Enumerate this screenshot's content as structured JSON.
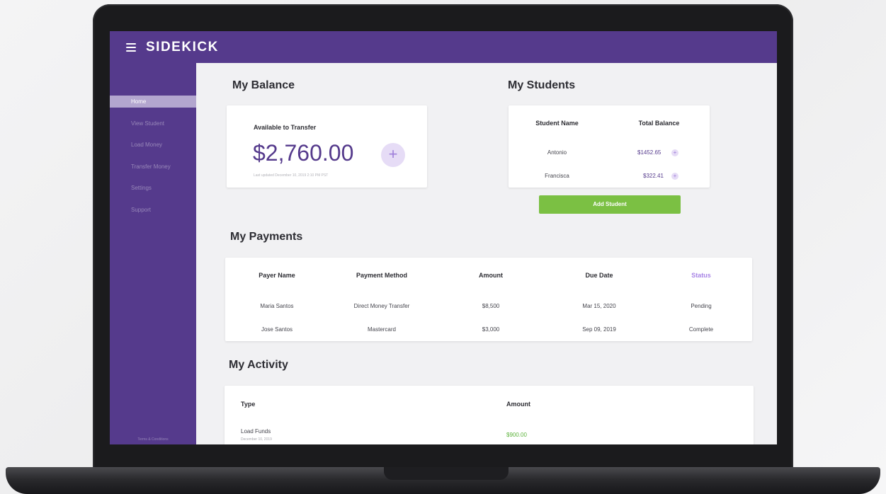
{
  "app": {
    "logo": "SIDEKICK"
  },
  "sidebar": {
    "items": [
      {
        "label": "Home",
        "active": true
      },
      {
        "label": "View Student"
      },
      {
        "label": "Load Money"
      },
      {
        "label": "Transfer Money"
      },
      {
        "label": "Settings"
      },
      {
        "label": "Support"
      }
    ],
    "footer": "Terms & Conditions"
  },
  "balance": {
    "title": "My Balance",
    "label": "Available to Transfer",
    "amount": "$2,760.00",
    "add_symbol": "+",
    "updated": "Last updated December 10, 2019 2:10 PM PST"
  },
  "students": {
    "title": "My Students",
    "headers": {
      "name": "Student Name",
      "balance": "Total Balance"
    },
    "rows": [
      {
        "name": "Antonio",
        "balance": "$1452.65"
      },
      {
        "name": "Francisca",
        "balance": "$322.41"
      }
    ],
    "row_plus": "+",
    "add_button": "Add Student"
  },
  "payments": {
    "title": "My Payments",
    "headers": {
      "payer": "Payer Name",
      "method": "Payment Method",
      "amount": "Amount",
      "due": "Due Date",
      "status": "Status"
    },
    "rows": [
      {
        "payer": "Maria Santos",
        "method": "Direct Money Transfer",
        "amount": "$8,500",
        "due": "Mar 15, 2020",
        "status": "Pending"
      },
      {
        "payer": "Jose Santos",
        "method": "Mastercard",
        "amount": "$3,000",
        "due": "Sep 09, 2019",
        "status": "Complete"
      }
    ]
  },
  "activity": {
    "title": "My Activity",
    "headers": {
      "type": "Type",
      "amount": "Amount"
    },
    "rows": [
      {
        "type": "Load Funds",
        "date": "December 10, 2019",
        "amount": "$900.00"
      }
    ]
  },
  "colors": {
    "brand": "#553a8c",
    "accent": "#a884e6",
    "success": "#7bc043"
  }
}
